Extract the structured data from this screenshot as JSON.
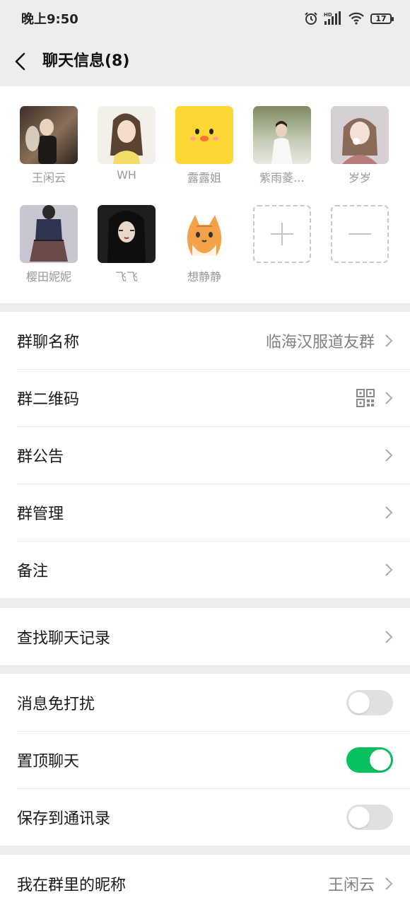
{
  "status_bar": {
    "time": "晚上9:50",
    "battery": "17",
    "hd_label": "HD"
  },
  "header": {
    "title": "聊天信息(8)"
  },
  "members": [
    {
      "name": "王闲云",
      "avatar_color": "#6b5a4a"
    },
    {
      "name": "WH",
      "avatar_color": "#f1ede4"
    },
    {
      "name": "露露姐",
      "avatar_color": "#fdd835"
    },
    {
      "name": "紫雨菱…",
      "avatar_color": "#9aa68a"
    },
    {
      "name": "岁岁",
      "avatar_color": "#c9c2c6"
    },
    {
      "name": "樱田妮妮",
      "avatar_color": "#4a4f6a"
    },
    {
      "name": "飞飞",
      "avatar_color": "#2a2a2a"
    },
    {
      "name": "想静静",
      "avatar_color": "#fafafa"
    }
  ],
  "group_settings": {
    "name_label": "群聊名称",
    "name_value": "临海汉服道友群",
    "qrcode_label": "群二维码",
    "notice_label": "群公告",
    "manage_label": "群管理",
    "remark_label": "备注"
  },
  "search": {
    "history_label": "查找聊天记录"
  },
  "toggles": {
    "mute_label": "消息免打扰",
    "mute_on": false,
    "pin_label": "置顶聊天",
    "pin_on": true,
    "save_label": "保存到通讯录",
    "save_on": false
  },
  "nickname": {
    "label": "我在群里的昵称",
    "value": "王闲云"
  },
  "colors": {
    "accent_green": "#07c160",
    "page_bg": "#ededed"
  }
}
